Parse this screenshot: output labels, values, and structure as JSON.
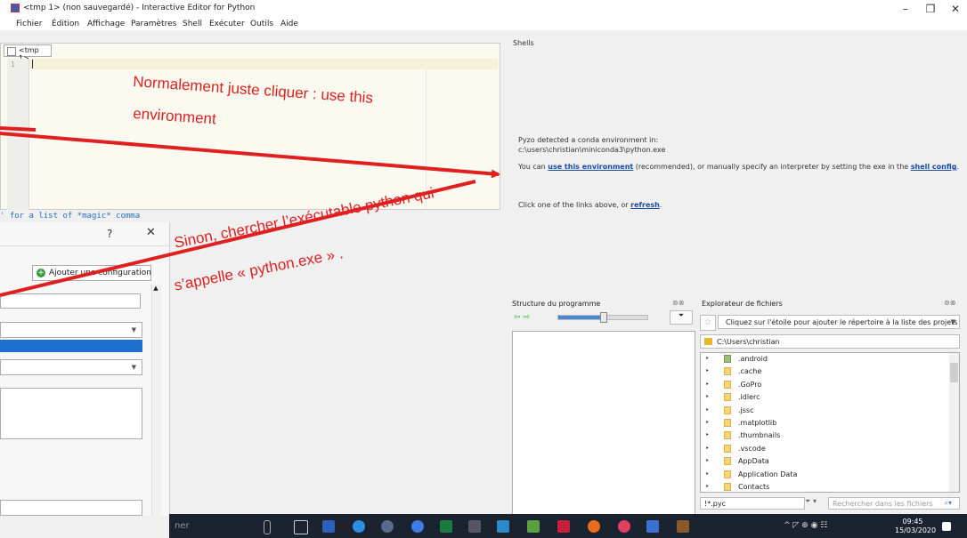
{
  "window": {
    "title": "<tmp 1> (non sauvegardé) - Interactive Editor for Python",
    "minimize": "–",
    "maximize": "❐",
    "close": "✕"
  },
  "menu": [
    "Fichier",
    "Édition",
    "Affichage",
    "Paramètres",
    "Shell",
    "Exécuter",
    "Outils",
    "Aide"
  ],
  "editor": {
    "tab_label": "<tmp 1>",
    "line_number": "1",
    "shell_hint": "' for a list of *magic* comma"
  },
  "dialog": {
    "help": "?",
    "close": "✕",
    "add_config_label": "Ajouter une configuration"
  },
  "shells": {
    "title": "Shells",
    "detected_line1": "Pyzo detected a conda environment in:",
    "detected_line2": "c:\\users\\christian\\miniconda3\\python.exe",
    "you_can": "You can ",
    "use_env_link": "use this environment",
    "middle": " (recommended), or manually specify an interpreter by setting the exe in the ",
    "shell_config_link": "shell config",
    "period": ".",
    "click_one": "Click one of the links above, or ",
    "refresh_link": "refresh",
    "period2": "."
  },
  "structure": {
    "title": "Structure du programme",
    "icons": "⊚⊗",
    "arrows": "⇦ ⇨",
    "slider_value": 0.5
  },
  "file_browser": {
    "title": "Explorateur de fichiers",
    "icons": "⊚⊗",
    "star": "☆",
    "project_hint": "Cliquez sur l'étoile pour ajouter le répertoire à la liste des projets",
    "path": "C:\\Users\\christian",
    "items": [
      ".android",
      ".cache",
      ".GoPro",
      ".idlerc",
      ".jssc",
      ".matplotlib",
      ".thumbnails",
      ".vscode",
      "AppData",
      "Application Data",
      "Contacts"
    ],
    "filter": "!*.pyc",
    "search_placeholder": "Rechercher dans les fichiers"
  },
  "taskbar": {
    "search_text": "ner",
    "time": "09:45",
    "date": "15/03/2020",
    "tray": "^ ◸ ⊕ ◉ ☷"
  },
  "annotations": {
    "note1_line1": "Normalement juste cliquer : use this",
    "note1_line2": "environment",
    "note2_line1": "Sinon, chercher l’exécutable python qui",
    "note2_line2": "s’appelle « python.exe » ."
  },
  "colors": {
    "annotation": "#e02020",
    "link": "#1a4da0",
    "taskbar": "#1b2330"
  }
}
